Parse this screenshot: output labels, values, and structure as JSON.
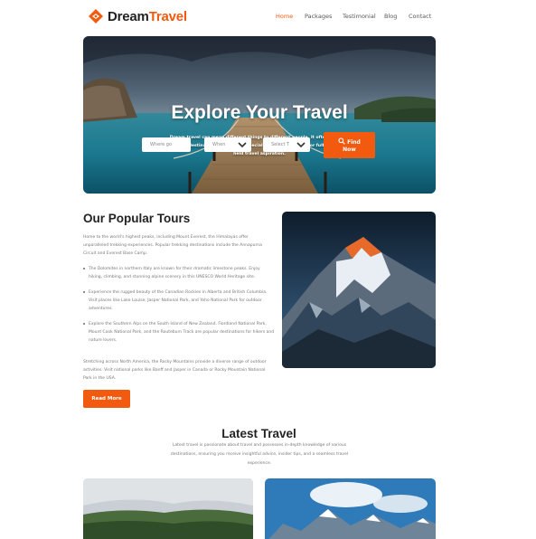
{
  "brand": {
    "name_part1": "Dream",
    "name_part2": "Travel",
    "accent": "#f15a0f"
  },
  "nav": {
    "home": "Home",
    "packages": "Packages",
    "testimonial": "Testimonial",
    "blog": "Blog",
    "contact": "Contact"
  },
  "hero": {
    "title": "Explore Your Travel",
    "description": "Dream travel can mean different things to different people. It often involves visiting a destination that holds a special place in your heart or fulfilling a long-held travel aspiration.",
    "search": {
      "where_placeholder": "Where go",
      "when_value": "When",
      "select_value": "Select T",
      "button_label_line1": "Find",
      "button_label_line2": "Now"
    }
  },
  "tours": {
    "title": "Our Popular Tours",
    "intro": "Home to the world's highest peaks, including Mount Everest, the Himalayas offer unparalleled trekking experiences. Popular trekking destinations include the Annapurna Circuit and Everest Base Camp.",
    "bullets": [
      "The Dolomites in northern Italy are known for their dramatic limestone peaks. Enjoy hiking, climbing, and stunning alpine scenery in this UNESCO World Heritage site.",
      "Experience the rugged beauty of the Canadian Rockies in Alberta and British Columbia. Visit places like Lake Louise, Jasper National Park, and Yoho National Park for outdoor adventures.",
      "Explore the Southern Alps on the South Island of New Zealand. Fiordland National Park, Mount Cook National Park, and the Routeburn Track are popular destinations for hikers and nature lovers."
    ],
    "outro": "Stretching across North America, the Rocky Mountains provide a diverse range of outdoor activities. Visit national parks like Banff and Jasper in Canada or Rocky Mountain National Park in the USA.",
    "button": "Read More"
  },
  "latest": {
    "title": "Latest Travel",
    "description": "Latest travel is passionate about travel and possesses in-depth knowledge of various destinations, ensuring you receive insightful advice, insider tips, and a seamless travel experience."
  }
}
